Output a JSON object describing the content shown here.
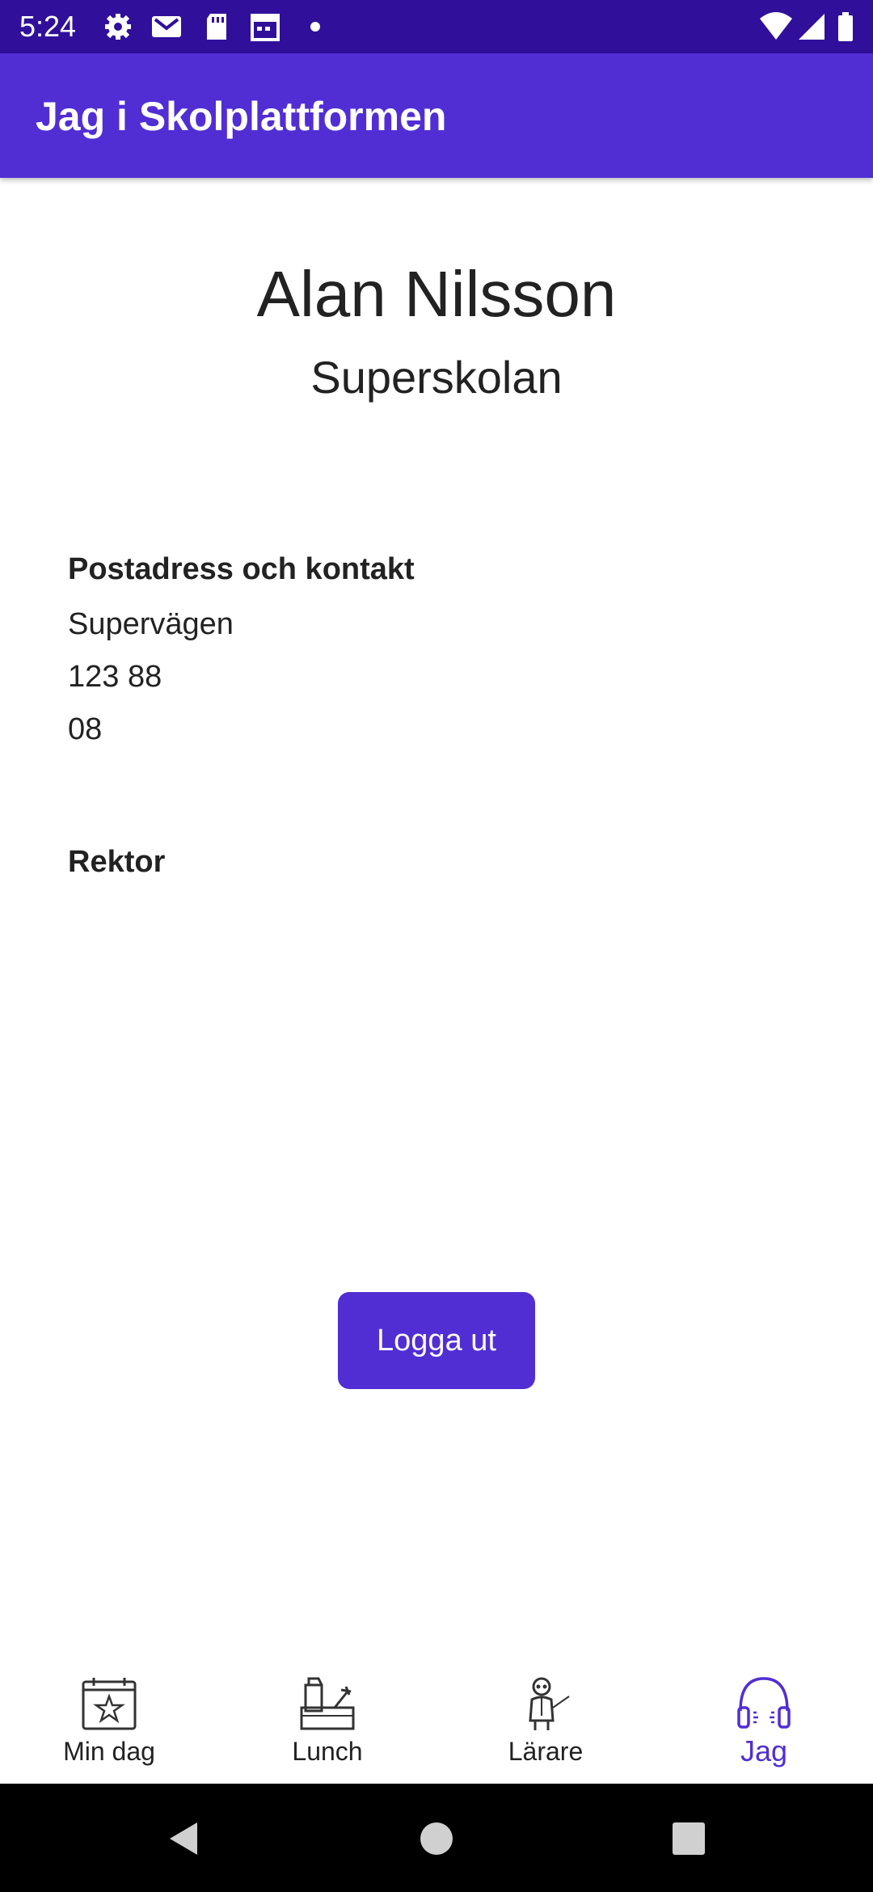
{
  "status_bar": {
    "time": "5:24",
    "icons": [
      "settings-icon",
      "gmail-icon",
      "sd-card-icon",
      "calendar-icon",
      "dot-icon",
      "wifi-icon",
      "signal-icon",
      "battery-icon"
    ]
  },
  "app_bar": {
    "title": "Jag i Skolplattformen"
  },
  "profile": {
    "name": "Alan Nilsson",
    "school": "Superskolan"
  },
  "contact": {
    "heading": "Postadress och kontakt",
    "lines": [
      "Supervägen",
      "123 88",
      "08"
    ]
  },
  "principal": {
    "heading": "Rektor"
  },
  "logout_button": {
    "label": "Logga ut"
  },
  "bottom_nav": {
    "items": [
      {
        "label": "Min dag",
        "icon": "calendar-star-icon",
        "active": false
      },
      {
        "label": "Lunch",
        "icon": "lunch-icon",
        "active": false
      },
      {
        "label": "Lärare",
        "icon": "teacher-icon",
        "active": false
      },
      {
        "label": "Jag",
        "icon": "headphones-icon",
        "active": true
      }
    ]
  },
  "colors": {
    "primary": "#512ed4",
    "status_bar": "#30109a",
    "text": "#222222"
  }
}
